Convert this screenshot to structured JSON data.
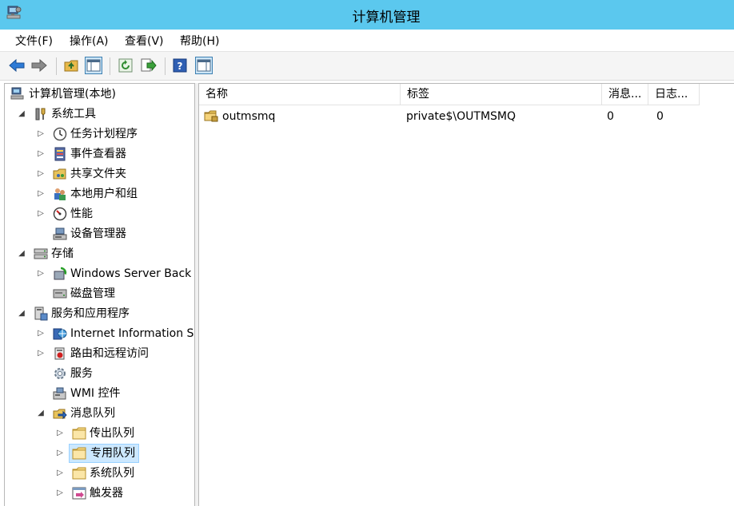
{
  "window": {
    "title": "计算机管理",
    "icon": "computer-management-icon"
  },
  "menu": [
    "文件(F)",
    "操作(A)",
    "查看(V)",
    "帮助(H)"
  ],
  "toolbar": {
    "buttons": [
      "back-icon",
      "forward-icon",
      "up-folder-icon",
      "show-hide-console-tree-icon",
      "refresh-icon",
      "export-list-icon",
      "help-icon",
      "show-hide-action-pane-icon"
    ]
  },
  "tree": {
    "root": "计算机管理(本地)",
    "system_tools": "系统工具",
    "task_scheduler": "任务计划程序",
    "event_viewer": "事件查看器",
    "shared_folders": "共享文件夹",
    "local_users": "本地用户和组",
    "performance": "性能",
    "device_manager": "设备管理器",
    "storage": "存储",
    "windows_server_backup": "Windows Server Back",
    "disk_management": "磁盘管理",
    "services_apps": "服务和应用程序",
    "iis": "Internet Information S",
    "routing": "路由和远程访问",
    "services": "服务",
    "wmi": "WMI 控件",
    "message_queuing": "消息队列",
    "outgoing_queues": "传出队列",
    "private_queues": "专用队列",
    "system_queues": "系统队列",
    "triggers": "触发器"
  },
  "list": {
    "columns": [
      "名称",
      "标签",
      "消息...",
      "日志..."
    ],
    "rows": [
      {
        "name": "outmsmq",
        "label": "private$\\OUTMSMQ",
        "messages": "0",
        "journal": "0"
      }
    ]
  },
  "colors": {
    "titlebar": "#5bc8ee",
    "selection": "#cce8ff",
    "selection_border": "#99d1ff"
  }
}
